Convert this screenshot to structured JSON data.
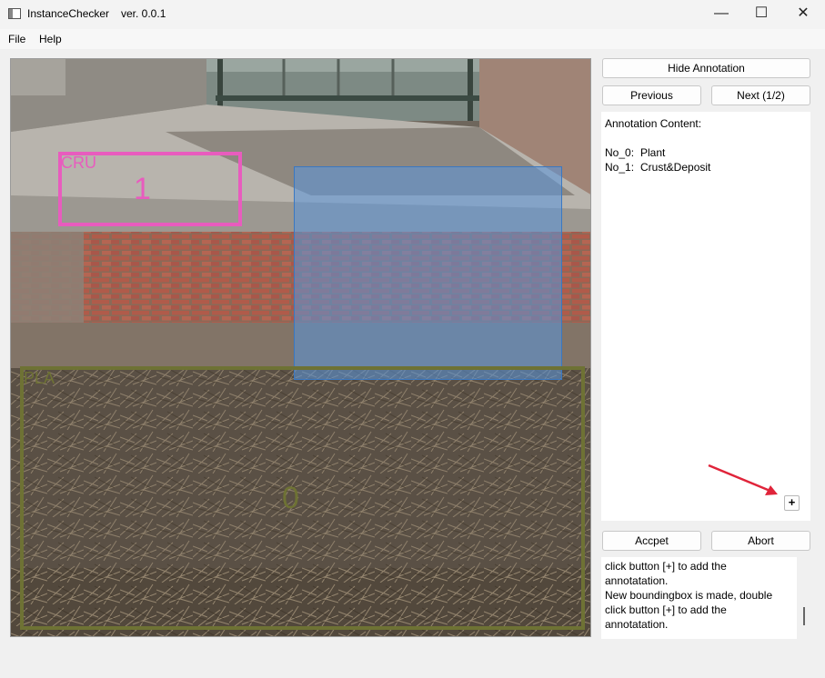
{
  "window": {
    "title": "InstanceChecker",
    "version": "ver.  0.0.1",
    "controls": {
      "minimize": "—",
      "maximize": "☐",
      "close": "✕"
    }
  },
  "menu": {
    "items": [
      "File",
      "Help"
    ]
  },
  "canvas": {
    "boxes": [
      {
        "tag": "CRU",
        "index": "1",
        "color": "#e85cbe"
      },
      {
        "tag": "",
        "index": "",
        "color": "#4a86c8"
      },
      {
        "tag": "PLA",
        "index": "0",
        "color": "#6e7234"
      }
    ]
  },
  "controls": {
    "hide_annotation": "Hide Annotation",
    "previous": "Previous",
    "next": "Next (1/2)",
    "accept": "Accpet",
    "abort": "Abort",
    "plus": "+"
  },
  "annotation": {
    "header": "Annotation Content:",
    "items": [
      {
        "id": "No_0:",
        "label": "Plant"
      },
      {
        "id": "No_1:",
        "label": "Crust&Deposit"
      }
    ]
  },
  "log": {
    "text": "click button [+] to add the\nannotatation.\nNew boundingbox is made, double\nclick button [+] to add the\nannotatation."
  }
}
